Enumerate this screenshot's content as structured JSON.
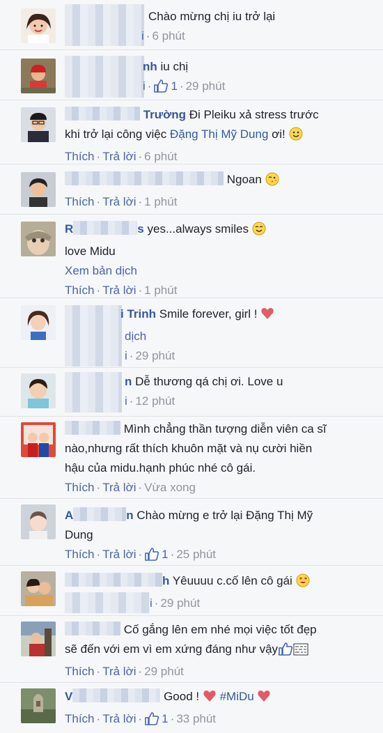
{
  "actions": {
    "like": "Thích",
    "reply": "Trả lời",
    "dot": "·"
  },
  "comments": [
    {
      "author_tail": "",
      "text": "Chào mừng chị iu trở lại",
      "reply_partial": "i",
      "time": "6 phút"
    },
    {
      "author_tail": "nh",
      "text": "iu chị",
      "reply_partial": "i",
      "likes": "1",
      "time": "29 phút"
    },
    {
      "author_tail": "Trường",
      "text_line1": "Đi Pleiku xả stress trước",
      "text_line2a": "khi trở lại công việc ",
      "mention": "Đặng Thị Mỹ Dung",
      "text_line2b": " ơi!",
      "time": "6 phút"
    },
    {
      "author_tail": "",
      "text": "Ngoan",
      "time": "1 phút"
    },
    {
      "author_head": "R",
      "author_tail": "s",
      "text_line1": "yes...always smiles",
      "text_line2": "love Midu",
      "see_translation": "Xem bản dịch",
      "time": "1 phút"
    },
    {
      "author_tail": "i Trinh",
      "text": "Smile forever, girl !",
      "translate_partial": "dịch",
      "reply_partial": "i",
      "time": "29 phút"
    },
    {
      "author_tail": "n",
      "text": "Dễ thương qá chị ơi. Love u",
      "reply_partial": "i",
      "time": "12 phút"
    },
    {
      "author_tail": "",
      "text_line1": "Mình chẳng thần tượng diễn viên ca sĩ",
      "text_line2": "nào,nhưng rất thích khuôn mặt và nụ cười hiền",
      "text_line3": "hậu của midu.hạnh phúc nhé cô gái.",
      "time": "Vừa xong"
    },
    {
      "author_head": "A",
      "author_tail": "n",
      "text_line1": "Chào mừng e trở lại Đặng Thị Mỹ",
      "text_line2": "Dung",
      "likes": "1",
      "time": "25 phút"
    },
    {
      "author_tail": "h",
      "text": "Yêuuuu c.cố lên cô gái",
      "reply_partial": "i",
      "time": "29 phút"
    },
    {
      "author_tail": "",
      "text_line1": "Cố gắng lên em nhé mọi việc tốt đẹp",
      "text_line2": "sẽ đến với em vì em xứng đáng như vậy",
      "time": "29 phút"
    },
    {
      "author_head": "V",
      "author_tail": "",
      "text": "Good !",
      "hashtag": "#MiDu",
      "likes": "1",
      "time": "33 phút"
    }
  ],
  "colors": {
    "link": "#365899",
    "action": "#4a64a6",
    "time": "#90949c",
    "background": "#f6f7f9"
  }
}
